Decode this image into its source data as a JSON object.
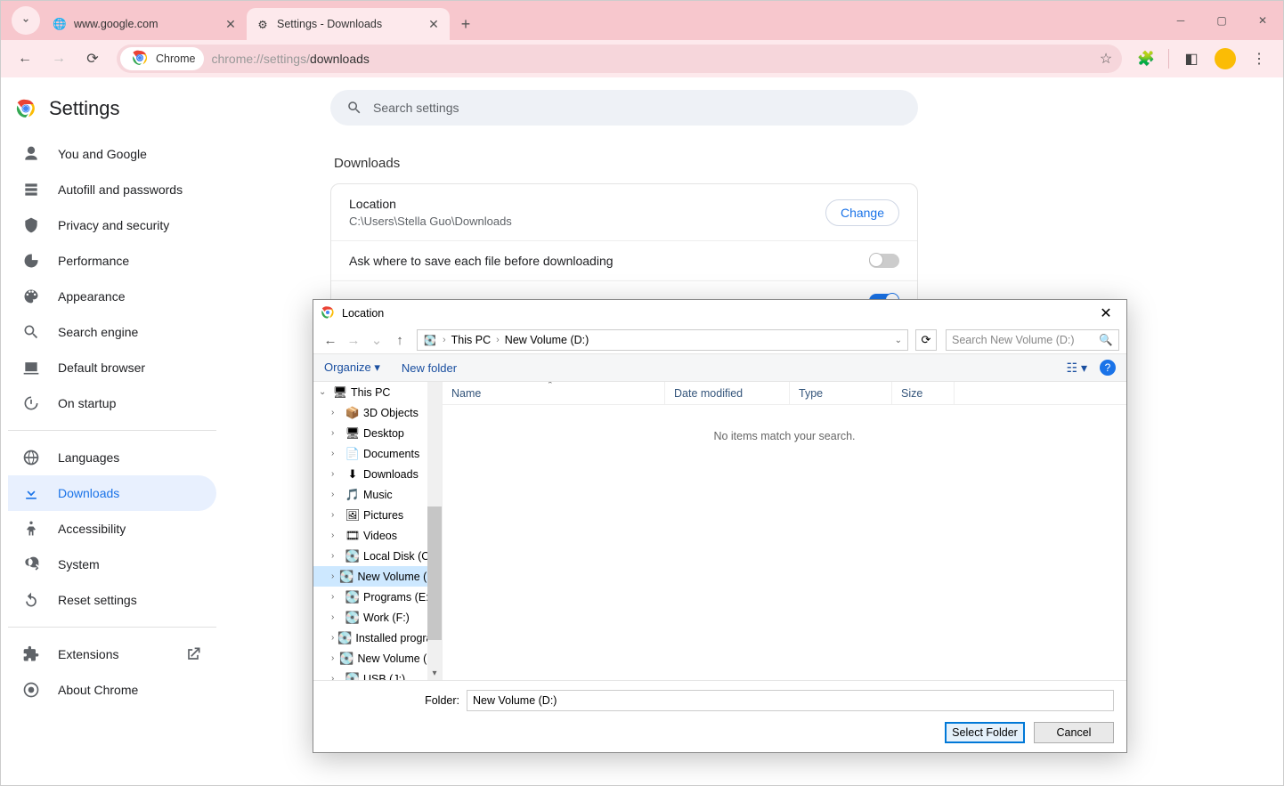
{
  "tabs": [
    {
      "title": "www.google.com",
      "active": false
    },
    {
      "title": "Settings - Downloads",
      "active": true
    }
  ],
  "omnibox": {
    "chip_label": "Chrome",
    "url_prefix": "chrome://settings/",
    "url_path": "downloads"
  },
  "settings_title": "Settings",
  "search_placeholder": "Search settings",
  "sidebar": {
    "items": [
      "You and Google",
      "Autofill and passwords",
      "Privacy and security",
      "Performance",
      "Appearance",
      "Search engine",
      "Default browser",
      "On startup"
    ],
    "items2": [
      "Languages",
      "Downloads",
      "Accessibility",
      "System",
      "Reset settings"
    ],
    "items3": [
      "Extensions",
      "About Chrome"
    ]
  },
  "downloads": {
    "section_title": "Downloads",
    "location_label": "Location",
    "location_path": "C:\\Users\\Stella Guo\\Downloads",
    "change_label": "Change",
    "ask_label": "Ask where to save each file before downloading"
  },
  "dialog": {
    "title": "Location",
    "breadcrumb": [
      "This PC",
      "New Volume (D:)"
    ],
    "search_placeholder": "Search New Volume (D:)",
    "organize_label": "Organize",
    "new_folder_label": "New folder",
    "columns": [
      "Name",
      "Date modified",
      "Type",
      "Size"
    ],
    "empty_message": "No items match your search.",
    "tree_root": "This PC",
    "tree_items": [
      {
        "label": "3D Objects",
        "icon": "📦"
      },
      {
        "label": "Desktop",
        "icon": "🖥"
      },
      {
        "label": "Documents",
        "icon": "📄"
      },
      {
        "label": "Downloads",
        "icon": "⬇"
      },
      {
        "label": "Music",
        "icon": "🎵"
      },
      {
        "label": "Pictures",
        "icon": "🖼"
      },
      {
        "label": "Videos",
        "icon": "🎞"
      },
      {
        "label": "Local Disk (C:)",
        "icon": "💽"
      },
      {
        "label": "New Volume (D:)",
        "icon": "💽",
        "selected": true
      },
      {
        "label": "Programs (E:)",
        "icon": "💽"
      },
      {
        "label": "Work (F:)",
        "icon": "💽"
      },
      {
        "label": "Installed programs",
        "icon": "💽"
      },
      {
        "label": "New Volume (H:)",
        "icon": "💽"
      },
      {
        "label": "USB (J:)",
        "icon": "💽"
      }
    ],
    "folder_label": "Folder:",
    "folder_value": "New Volume (D:)",
    "select_label": "Select Folder",
    "cancel_label": "Cancel"
  }
}
